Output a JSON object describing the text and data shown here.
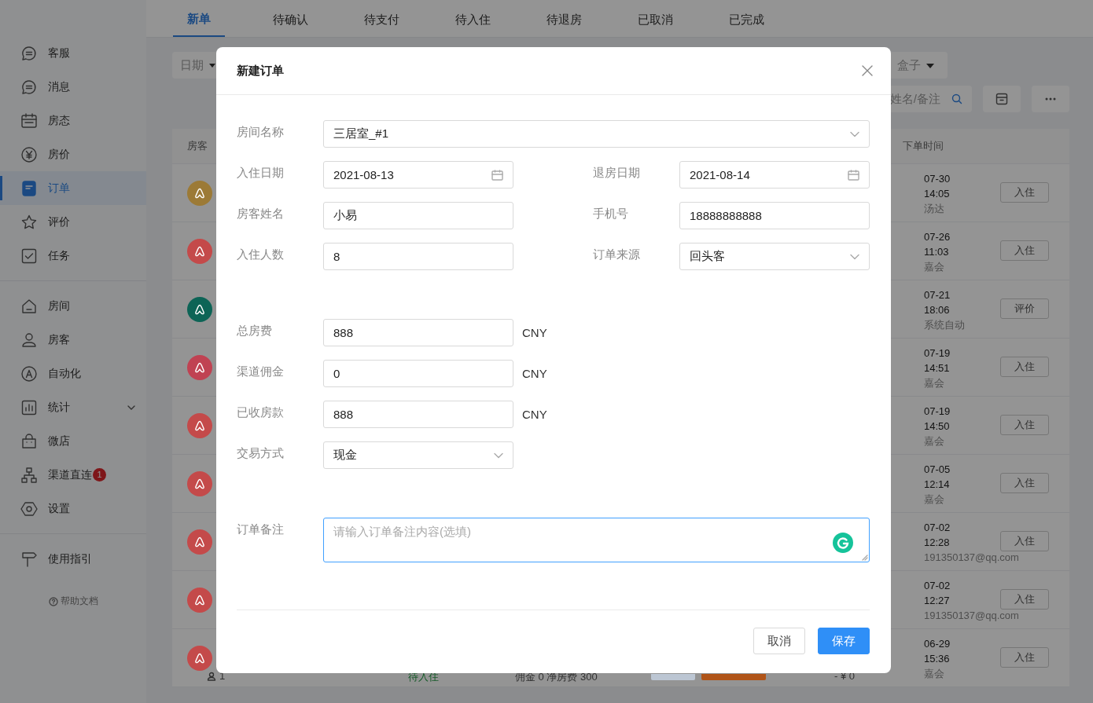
{
  "sidebar": {
    "groups": [
      {
        "items": [
          {
            "label": "客服",
            "selected": false
          },
          {
            "label": "消息",
            "selected": false
          },
          {
            "label": "房态",
            "selected": false
          },
          {
            "label": "房价",
            "selected": false
          },
          {
            "label": "订单",
            "selected": true
          },
          {
            "label": "评价",
            "selected": false
          },
          {
            "label": "任务",
            "selected": false
          }
        ]
      },
      {
        "items": [
          {
            "label": "房间",
            "selected": false
          },
          {
            "label": "房客",
            "selected": false
          },
          {
            "label": "自动化",
            "selected": false
          },
          {
            "label": "统计",
            "selected": false,
            "expanded": false
          },
          {
            "label": "微店",
            "selected": false
          },
          {
            "label": "渠道直连",
            "selected": false,
            "badge": "1"
          },
          {
            "label": "设置",
            "selected": false
          }
        ]
      },
      {
        "items": [
          {
            "label": "使用指引",
            "selected": false
          }
        ]
      }
    ],
    "help_link": "帮助文档"
  },
  "tabs": [
    {
      "label": "新单",
      "selected": true
    },
    {
      "label": "待确认",
      "selected": false
    },
    {
      "label": "待支付",
      "selected": false
    },
    {
      "label": "待入住",
      "selected": false
    },
    {
      "label": "待退房",
      "selected": false
    },
    {
      "label": "已取消",
      "selected": false
    },
    {
      "label": "已完成",
      "selected": false
    }
  ],
  "filters": {
    "date": "日期",
    "box": "盒子",
    "search_placeholder": "姓名/备注"
  },
  "table": {
    "columns": [
      "房客",
      "下单时间"
    ],
    "rows": [
      {
        "color": "#9c7a36",
        "date": "07-30",
        "time": "14:05",
        "operator": "汤达",
        "action": "入住"
      },
      {
        "color": "#c44a4a",
        "date": "07-26",
        "time": "11:03",
        "operator": "嘉会",
        "action": "入住"
      },
      {
        "color": "#0d6456",
        "date": "07-21",
        "time": "18:06",
        "operator": "系统自动",
        "action": "评价"
      },
      {
        "color": "#c04252",
        "date": "07-19",
        "time": "14:51",
        "operator": "嘉会",
        "action": "入住"
      },
      {
        "color": "#c44a4a",
        "date": "07-19",
        "time": "14:50",
        "operator": "嘉会",
        "action": "入住"
      },
      {
        "color": "#c44a4a",
        "date": "07-05",
        "time": "12:14",
        "operator": "嘉会",
        "action": "入住"
      },
      {
        "color": "#c44a4a",
        "date": "07-02",
        "time": "12:28",
        "operator": "191350137@qq.com",
        "action": "入住"
      },
      {
        "color": "#c44a4a",
        "date": "07-02",
        "time": "12:27",
        "operator": "191350137@qq.com",
        "action": "入住"
      },
      {
        "color": "#c44a4a",
        "date": "06-29",
        "time": "15:36",
        "operator": "嘉会",
        "action": "入住",
        "guests": "1",
        "status": "待入住",
        "fees": "佣金 0 净房费 300",
        "tags": [
          {
            "color": "#bcc6d3"
          },
          {
            "color": "#b05418"
          }
        ],
        "amount": "- ¥ 0"
      }
    ]
  },
  "modal": {
    "title": "新建订单",
    "sections": [
      {
        "rows": [
          [
            {
              "label": "房间名称",
              "kind": "select",
              "value": "三居室_#1",
              "wide": true
            }
          ],
          [
            {
              "label": "入住日期",
              "kind": "date",
              "value": "2021-08-13"
            },
            {
              "label": "退房日期",
              "kind": "date",
              "value": "2021-08-14"
            }
          ],
          [
            {
              "label": "房客姓名",
              "kind": "text",
              "value": "小易"
            },
            {
              "label": "手机号",
              "kind": "text",
              "value": "18888888888"
            }
          ],
          [
            {
              "label": "入住人数",
              "kind": "text",
              "value": "8"
            },
            {
              "label": "订单来源",
              "kind": "select",
              "value": "回头客"
            }
          ]
        ]
      },
      {
        "rows": [
          [
            {
              "label": "总房费",
              "kind": "text",
              "value": "888",
              "suffix": "CNY"
            }
          ],
          [
            {
              "label": "渠道佣金",
              "kind": "text",
              "value": "0",
              "suffix": "CNY"
            }
          ],
          [
            {
              "label": "已收房款",
              "kind": "text",
              "value": "888",
              "suffix": "CNY"
            }
          ],
          [
            {
              "label": "交易方式",
              "kind": "select",
              "value": "现金"
            }
          ]
        ]
      },
      {
        "rows": [
          [
            {
              "label": "订单备注",
              "kind": "textarea",
              "placeholder": "请输入订单备注内容(选填)",
              "focused": true,
              "wide": true
            }
          ]
        ]
      }
    ],
    "buttons": [
      {
        "label": "取消",
        "primary": false
      },
      {
        "label": "保存",
        "primary": true
      }
    ]
  }
}
